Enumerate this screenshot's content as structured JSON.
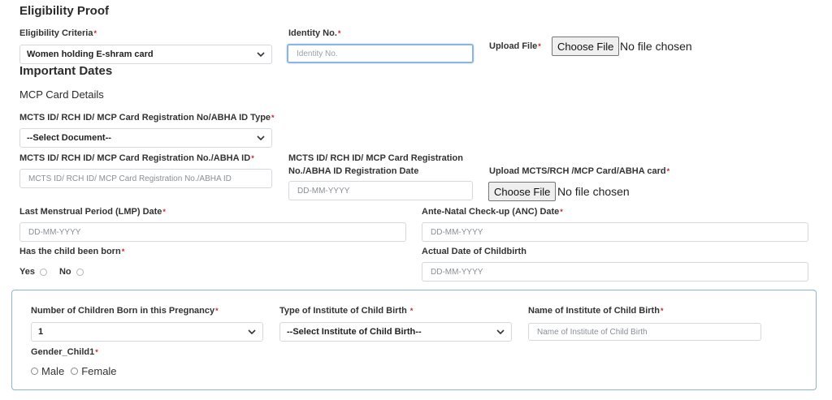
{
  "eligibility": {
    "title": "Eligibility Proof",
    "criteria_label": "Eligibility Criteria",
    "criteria_value": "Women holding E-shram card",
    "identity_label": "Identity No.",
    "identity_placeholder": "Identity No.",
    "upload_label": "Upload File",
    "choose_file": "Choose File",
    "no_file": "No file chosen"
  },
  "important_dates": {
    "title": "Important Dates"
  },
  "mcp": {
    "title": "MCP Card Details",
    "id_type_label": "MCTS ID/ RCH ID/ MCP Card Registration No/ABHA ID Type",
    "id_type_value": "--Select Document--",
    "id_label": "MCTS ID/ RCH ID/ MCP Card Registration No./ABHA ID",
    "id_placeholder": "MCTS ID/ RCH ID/ MCP Card Registration No./ABHA ID",
    "reg_date_label_line1": "MCTS ID/ RCH ID/ MCP Card Registration",
    "reg_date_label_line2": "No./ABHA ID Registration Date",
    "reg_date_placeholder": "DD-MM-YYYY",
    "upload_card_label": "Upload MCTS/RCH /MCP Card/ABHA card",
    "choose_file": "Choose File",
    "no_file": "No file chosen"
  },
  "dates": {
    "lmp_label": "Last Menstrual Period (LMP) Date",
    "lmp_placeholder": "DD-MM-YYYY",
    "anc_label": "Ante-Natal Check-up (ANC) Date",
    "anc_placeholder": "DD-MM-YYYY",
    "born_label": "Has the child been born",
    "yes": "Yes",
    "no": "No",
    "actual_label": "Actual Date of Childbirth",
    "actual_placeholder": "DD-MM-YYYY"
  },
  "child_panel": {
    "num_children_label": "Number of Children Born in this Pregnancy",
    "num_children_value": "1",
    "institute_type_label": "Type of Institute of Child Birth",
    "institute_type_value": "--Select Institute of Child Birth--",
    "institute_name_label": "Name of Institute of Child Birth",
    "institute_name_placeholder": "Name of Institute of Child Birth",
    "gender_label": "Gender_Child1",
    "male": "Male",
    "female": "Female"
  },
  "required_mark": "*",
  "colors": {
    "required": "#d0202a",
    "focus_border": "#8db5e3",
    "panel_border": "#8cb4d9"
  }
}
